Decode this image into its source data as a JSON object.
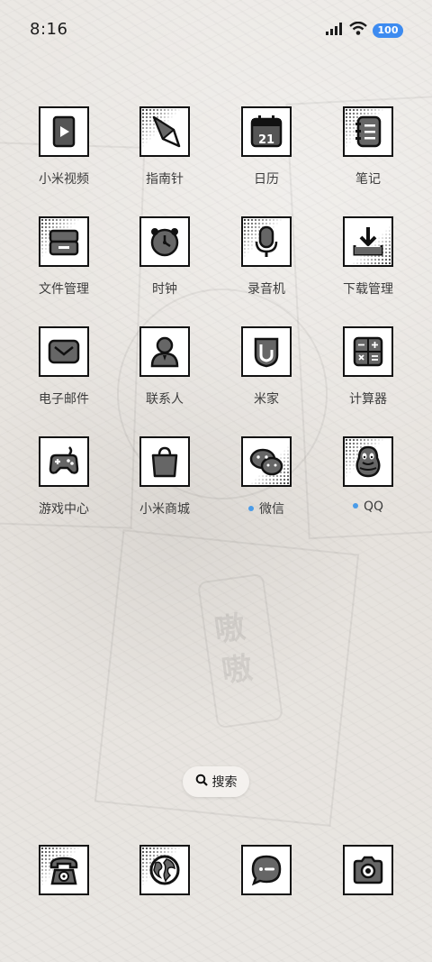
{
  "status_bar": {
    "time": "8:16",
    "battery_level": "100",
    "battery_color": "#3d8bf0",
    "icons": [
      "signal-icon",
      "wifi-icon",
      "battery-icon"
    ]
  },
  "apps": [
    {
      "label": "小米视频",
      "icon": "video-icon"
    },
    {
      "label": "指南针",
      "icon": "compass-icon"
    },
    {
      "label": "日历",
      "icon": "calendar-icon",
      "badge_text": "21"
    },
    {
      "label": "笔记",
      "icon": "notes-icon"
    },
    {
      "label": "文件管理",
      "icon": "file-manager-icon"
    },
    {
      "label": "时钟",
      "icon": "clock-icon"
    },
    {
      "label": "录音机",
      "icon": "microphone-icon"
    },
    {
      "label": "下载管理",
      "icon": "download-icon"
    },
    {
      "label": "电子邮件",
      "icon": "email-icon"
    },
    {
      "label": "联系人",
      "icon": "contacts-icon"
    },
    {
      "label": "米家",
      "icon": "mijia-icon"
    },
    {
      "label": "计算器",
      "icon": "calculator-icon"
    },
    {
      "label": "游戏中心",
      "icon": "gamepad-icon"
    },
    {
      "label": "小米商城",
      "icon": "shopping-bag-icon"
    },
    {
      "label": "微信",
      "icon": "wechat-icon",
      "new_dot": true
    },
    {
      "label": "QQ",
      "icon": "qq-penguin-icon",
      "new_dot": true
    }
  ],
  "new_dot_color": "#4a9be8",
  "search": {
    "label": "搜索",
    "icon": "search-icon"
  },
  "dock": [
    {
      "icon": "phone-icon"
    },
    {
      "icon": "browser-globe-icon"
    },
    {
      "icon": "messages-icon"
    },
    {
      "icon": "camera-icon"
    }
  ],
  "wallpaper": {
    "lettering": [
      "嗷",
      "嗷"
    ]
  }
}
